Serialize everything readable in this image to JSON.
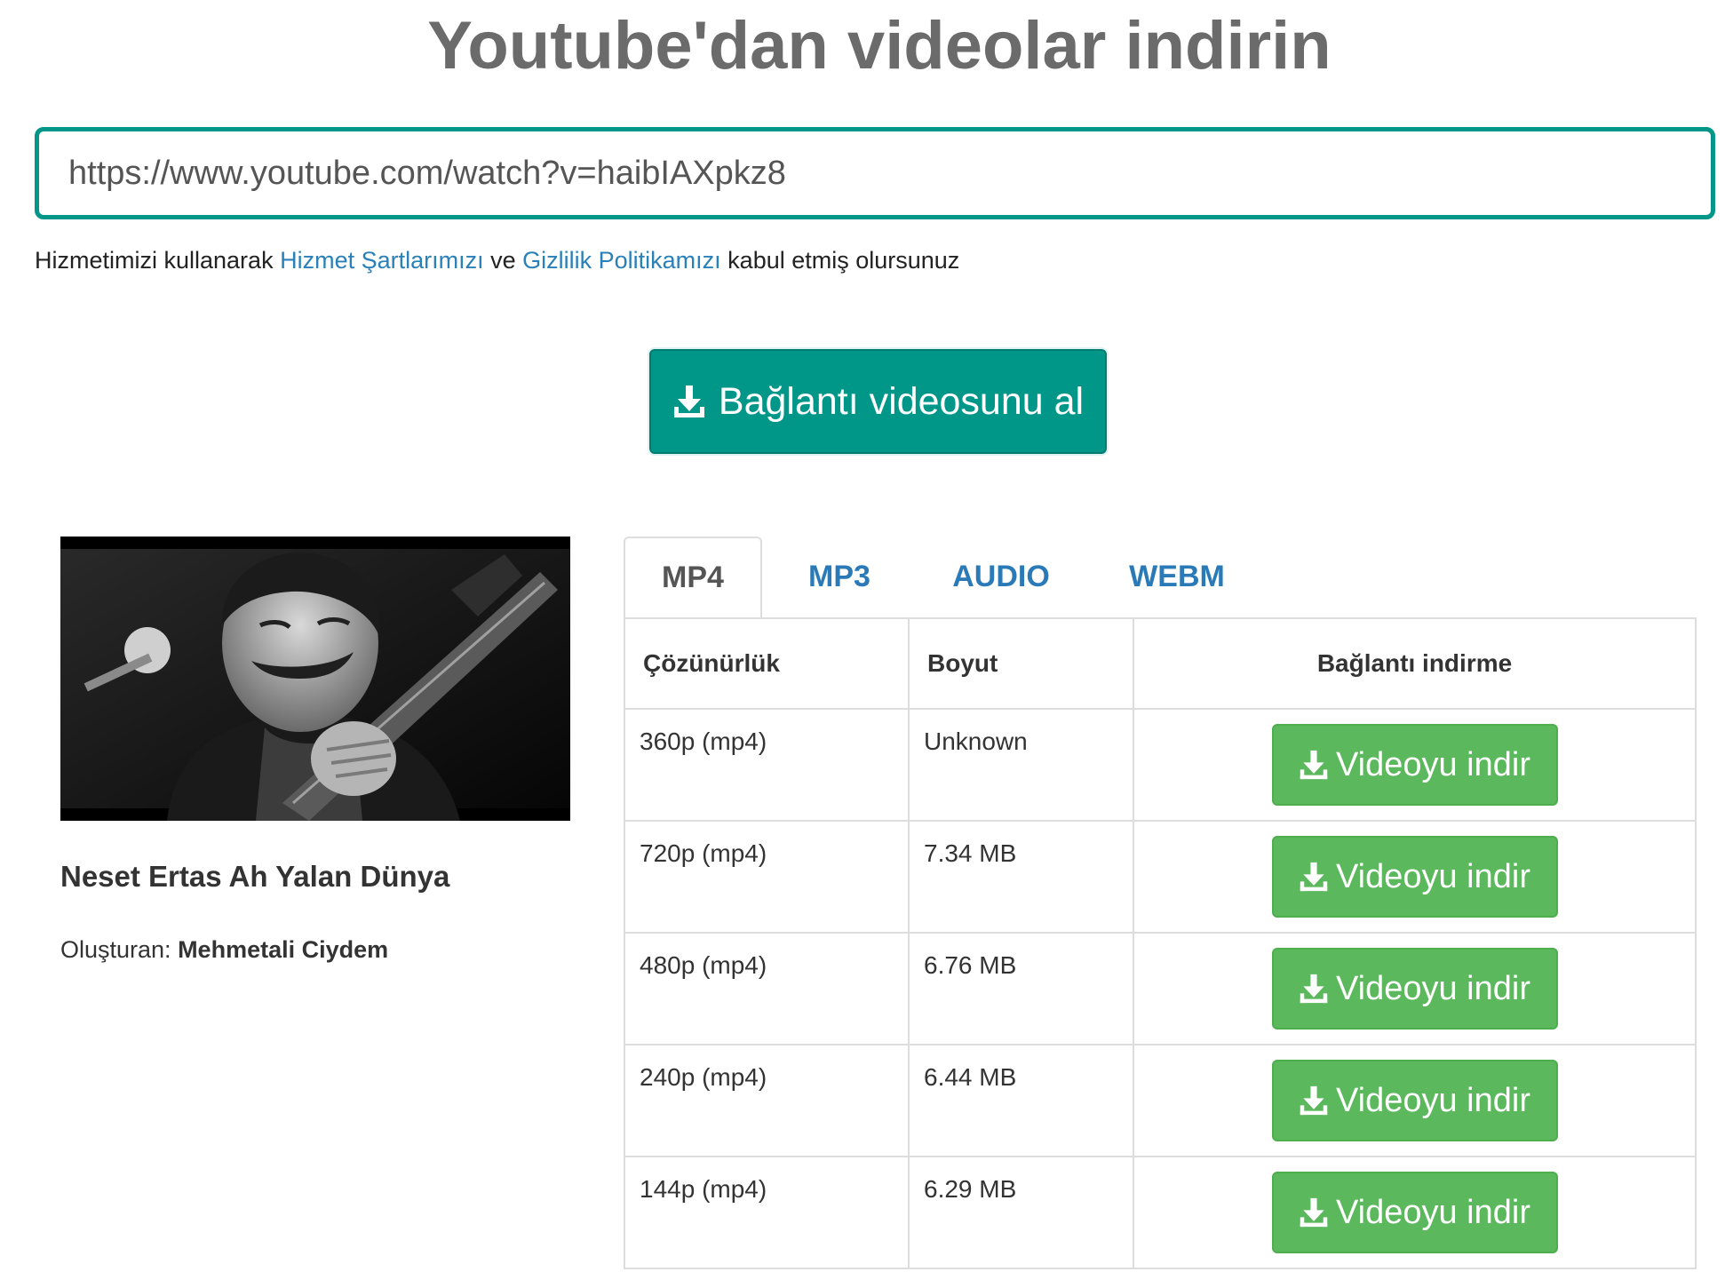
{
  "header": {
    "title": "Youtube'dan videolar indirin"
  },
  "search": {
    "value": "https://www.youtube.com/watch?v=haibIAXpkz8"
  },
  "terms": {
    "prefix": "Hizmetimizi kullanarak ",
    "terms_link": "Hizmet Şartlarımızı",
    "middle": " ve ",
    "privacy_link": "Gizlilik Politikamızı",
    "suffix": " kabul etmiş olursunuz"
  },
  "get_button": {
    "label": "Bağlantı videosunu al",
    "icon": "download-icon"
  },
  "video": {
    "title": "Neset Ertas Ah Yalan Dünya",
    "author_label": "Oluşturan: ",
    "author": "Mehmetali Ciydem"
  },
  "tabs": [
    {
      "label": "MP4",
      "active": true
    },
    {
      "label": "MP3",
      "active": false
    },
    {
      "label": "AUDIO",
      "active": false
    },
    {
      "label": "WEBM",
      "active": false
    }
  ],
  "table": {
    "headers": [
      "Çözünürlük",
      "Boyut",
      "Bağlantı indirme"
    ],
    "rows": [
      {
        "resolution": "360p (mp4)",
        "size": "Unknown",
        "button": "Videoyu indir"
      },
      {
        "resolution": "720p (mp4)",
        "size": "7.34 MB",
        "button": "Videoyu indir"
      },
      {
        "resolution": "480p (mp4)",
        "size": "6.76 MB",
        "button": "Videoyu indir"
      },
      {
        "resolution": "240p (mp4)",
        "size": "6.44 MB",
        "button": "Videoyu indir"
      },
      {
        "resolution": "144p (mp4)",
        "size": "6.29 MB",
        "button": "Videoyu indir"
      }
    ]
  },
  "colors": {
    "accent": "#009688",
    "link": "#2a80b9",
    "download_green": "#5cb85c",
    "title_gray": "#6b6b6b"
  }
}
